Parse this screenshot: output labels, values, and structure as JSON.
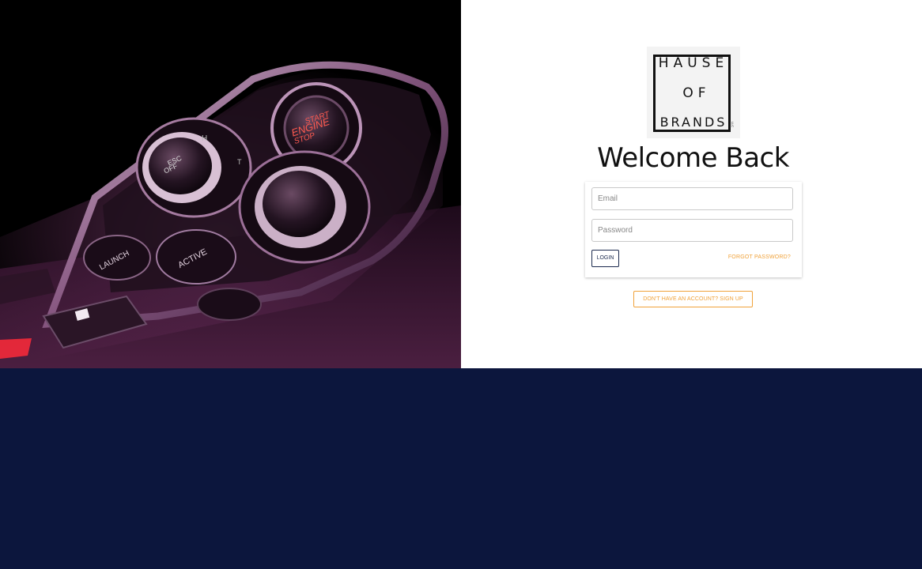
{
  "logo": {
    "line1": "HAUSE",
    "line2": "OF",
    "line3": "BRANDS",
    "trademark": "LLC"
  },
  "hero": {
    "button_start": [
      "START",
      "ENGINE",
      "STOP"
    ],
    "button_esc": [
      "ESC",
      "OFF"
    ],
    "button_launch": "LAUNCH",
    "button_active": "ACTIVE",
    "button_h": "H",
    "button_t": "T"
  },
  "login": {
    "title": "Welcome Back",
    "email_placeholder": "Email",
    "password_placeholder": "Password",
    "login_label": "LOGIN",
    "forgot_label": "FORGOT PASSWORD?",
    "signup_label": "DON'T HAVE AN ACCOUNT? SIGN UP"
  },
  "colors": {
    "accent": "#f0a23a",
    "navy": "#0c163d",
    "button_border": "#1b2a4e"
  }
}
